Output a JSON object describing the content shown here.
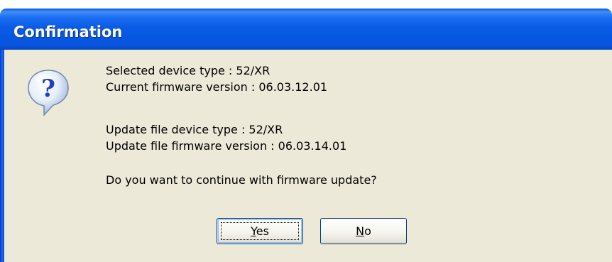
{
  "dialog": {
    "title": "Confirmation",
    "icon": "question-icon",
    "lines": {
      "selected_device_type": "Selected device type :  52/XR",
      "current_firmware_version": "Current firmware version :  06.03.12.01",
      "update_file_device_type": "Update file device type :  52/XR",
      "update_file_firmware_version": "Update file firmware version :  06.03.14.01",
      "question": "Do you want to continue with firmware update?"
    },
    "buttons": {
      "yes": {
        "accel": "Y",
        "rest": "es"
      },
      "no": {
        "accel": "N",
        "rest": "o"
      }
    },
    "colors": {
      "titlebar": "#0a5ce6",
      "title_text": "#ffffff",
      "dialog_background": "#ece9d8",
      "button_border": "#003c74"
    }
  }
}
